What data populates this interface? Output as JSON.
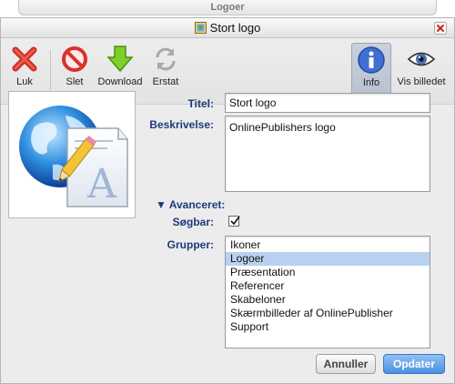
{
  "background_window": {
    "title": "Logoer"
  },
  "window": {
    "title": "Stort logo"
  },
  "toolbar": {
    "close_label": "Luk",
    "delete_label": "Slet",
    "download_label": "Download",
    "replace_label": "Erstat",
    "info_label": "Info",
    "view_label": "Vis billedet"
  },
  "form": {
    "title_label": "Titel:",
    "title_value": "Stort logo",
    "description_label": "Beskrivelse:",
    "description_value": "OnlinePublishers logo",
    "advanced_label": "Avanceret:",
    "searchable_label": "Søgbar:",
    "searchable_checked": true,
    "groups_label": "Grupper:",
    "groups": [
      "Ikoner",
      "Logoer",
      "Præsentation",
      "Referencer",
      "Skabeloner",
      "Skærmbilleder af OnlinePublisher",
      "Support"
    ],
    "selected_group": "Logoer"
  },
  "buttons": {
    "cancel_label": "Annuller",
    "update_label": "Opdater"
  },
  "icons": {
    "close": "red-x-icon",
    "delete": "forbidden-icon",
    "download": "green-down-arrow-icon",
    "replace": "refresh-icon",
    "info": "info-icon",
    "view": "eye-icon"
  },
  "colors": {
    "label_blue": "#1f3a7a",
    "selection": "#b9d1f1",
    "primary_button": "#4a90e0"
  }
}
